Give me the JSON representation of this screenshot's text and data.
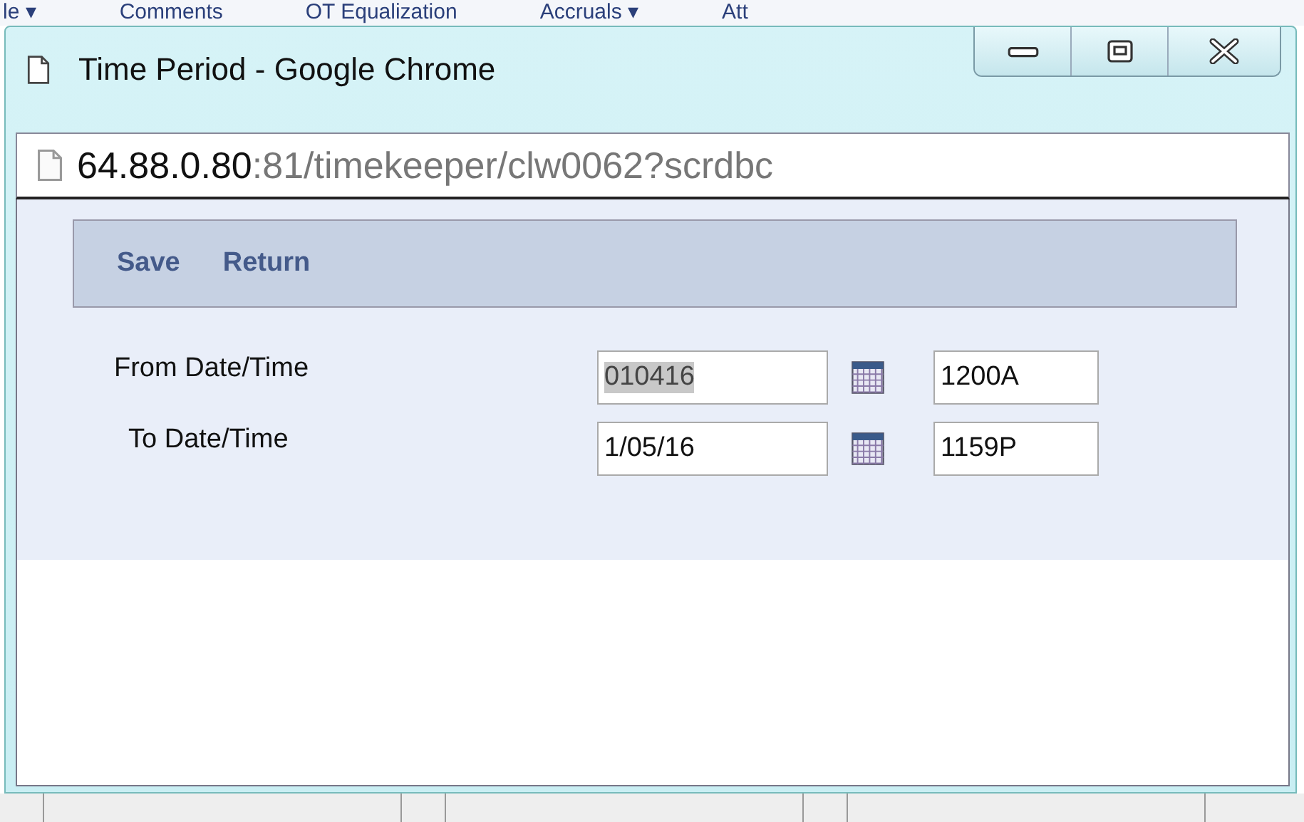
{
  "background_menu": [
    "le ▾",
    "Comments",
    "OT Equalization",
    "Accruals ▾",
    "Att"
  ],
  "window": {
    "title": "Time Period - Google Chrome"
  },
  "address_bar": {
    "host": "64.88.0.80",
    "rest": ":81/timekeeper/clw0062?scrdbc"
  },
  "toolbar": [
    "Save",
    "Return"
  ],
  "fields": [
    {
      "label": "From Date/Time",
      "date": "010416",
      "highlighted": true,
      "time": "1200A"
    },
    {
      "label": "To Date/Time",
      "date": "1/05/16",
      "highlighted": false,
      "time": "1159P"
    }
  ]
}
